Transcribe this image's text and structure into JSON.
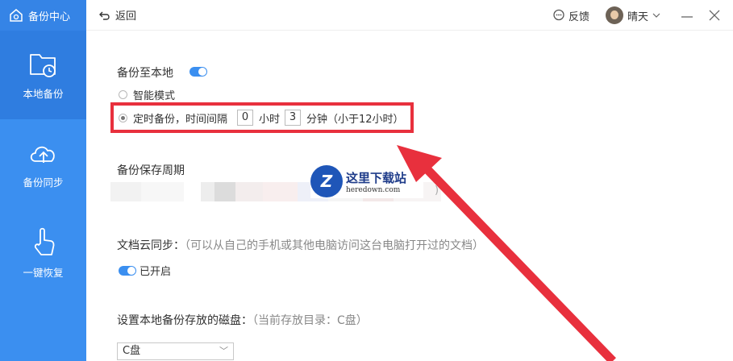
{
  "sidebar": {
    "title": "备份中心",
    "items": [
      {
        "label": "本地备份",
        "icon": "folder-clock-icon"
      },
      {
        "label": "备份同步",
        "icon": "cloud-upload-icon"
      },
      {
        "label": "一键恢复",
        "icon": "hand-pointer-icon"
      }
    ]
  },
  "topbar": {
    "back_label": "返回",
    "feedback_label": "反馈",
    "user_name": "晴天"
  },
  "local_backup": {
    "title": "备份至本地",
    "mode_smart": "智能模式",
    "mode_timed_prefix": "定时备份，时间间隔",
    "hours_value": "0",
    "hours_unit": "小时",
    "minutes_value": "3",
    "minutes_unit": "分钟（小于12小时）"
  },
  "retention": {
    "title": "备份保存周期",
    "trailing": ")"
  },
  "doc_sync": {
    "title": "文档云同步：",
    "hint": "（可以从自己的手机或其他电脑访问这台电脑打开过的文档）",
    "status": "已开启"
  },
  "disk": {
    "title": "设置本地备份存放的磁盘：",
    "hint": "（当前存放目录：C盘）",
    "selected": "C盘"
  },
  "watermark": {
    "logo_letter": "Z",
    "name": "这里下载站",
    "domain": "heredown.com"
  },
  "colors": {
    "accent": "#3b8ff0",
    "highlight": "#e8303d"
  }
}
